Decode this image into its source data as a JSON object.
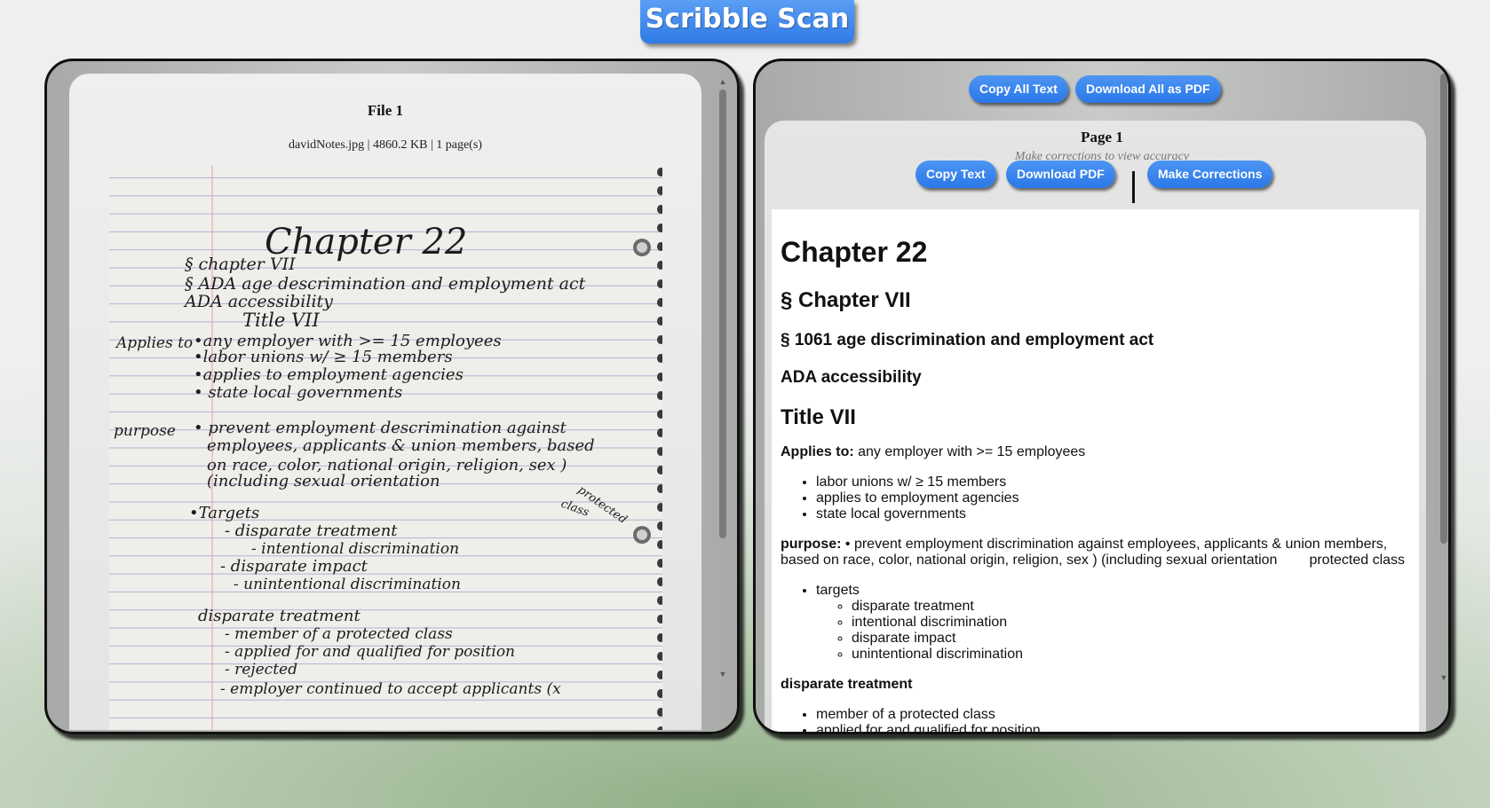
{
  "app": {
    "title": "Scribble Scan"
  },
  "file_panel": {
    "title": "File 1",
    "meta": "davidNotes.jpg | 4860.2 KB | 1 page(s)",
    "image_alt": "Handwritten notes page: Chapter 22"
  },
  "output_panel": {
    "copy_all_label": "Copy All Text",
    "download_all_label": "Download All as PDF",
    "page": {
      "title": "Page 1",
      "hint": "Make corrections to view accuracy",
      "copy_label": "Copy Text",
      "download_label": "Download PDF",
      "corrections_label": "Make Corrections"
    },
    "doc": {
      "h_chapter": "Chapter 22",
      "h_chapter7": "§ Chapter VII",
      "h_1061": "§ 1061 age discrimination and employment act",
      "h_ada": "ADA accessibility",
      "h_title7": "Title VII",
      "applies_label": "Applies to:",
      "applies_text": " any employer with >= 15 employees",
      "applies_items": [
        "labor unions w/ ≥ 15 members",
        "applies to employment agencies",
        "state local governments"
      ],
      "purpose_label": "purpose:",
      "purpose_text": " • prevent employment discrimination against employees, applicants & union members, based on race, color, national origin, religion, sex ) (including sexual orientation",
      "purpose_tail": "protected class",
      "targets_label": "targets",
      "targets_items": [
        "disparate treatment",
        "intentional discrimination",
        "disparate impact",
        "unintentional discrimination"
      ],
      "dt_heading": "disparate treatment",
      "dt_items": [
        "member of a protected class",
        "applied for and qualified for position"
      ]
    }
  },
  "handwriting": {
    "title": "Chapter 22",
    "lines": [
      "§ chapter VII",
      "§ ADA    age descrimination and employment act",
      "ADA      accessibility",
      "Title VII",
      "•any employer with >= 15 employees",
      "•labor unions w/ ≥ 15 members",
      "•applies to employment agencies",
      "• state local governments",
      "• prevent employment descrimination against",
      "employees, applicants & union members, based",
      "on race, color, national origin, religion, sex )",
      "(including sexual orientation",
      "•Targets",
      "- disparate treatment",
      "- intentional discrimination",
      "- disparate impact",
      "- unintentional discrimination",
      "disparate treatment",
      "- member of a protected class",
      "- applied for and qualified for position",
      "- rejected",
      "- employer continued to accept applicants (x"
    ],
    "margin_notes": [
      "Applies to",
      "purpose"
    ],
    "side_note": [
      "protected",
      "class"
    ]
  }
}
